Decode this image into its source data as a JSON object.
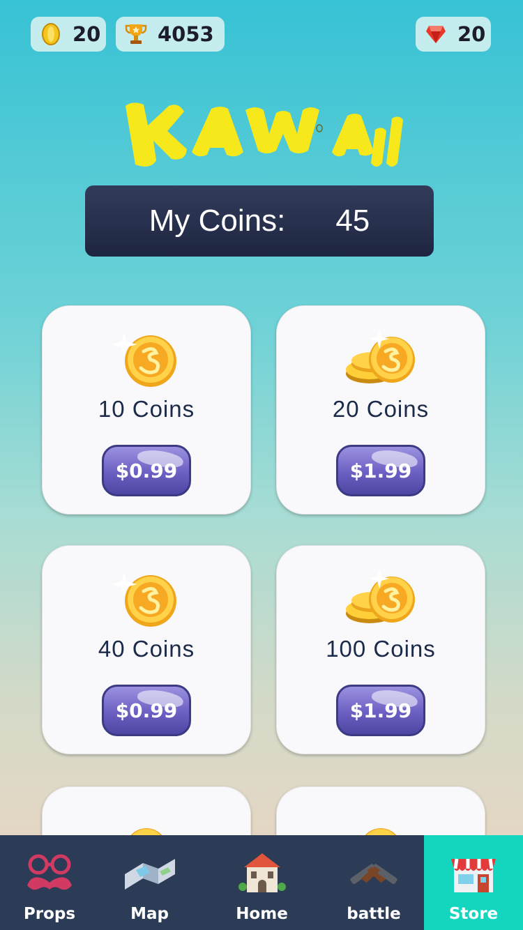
{
  "status": {
    "coins": "20",
    "trophies": "4053",
    "gems": "20"
  },
  "logo_text": "Kawaii",
  "my_coins": {
    "label": "My Coins:",
    "value": "45"
  },
  "products": [
    {
      "name": "10 Coins",
      "price": "$0.99",
      "icon": "single-coin-icon"
    },
    {
      "name": "20 Coins",
      "price": "$1.99",
      "icon": "coin-stack-icon"
    },
    {
      "name": "40 Coins",
      "price": "$0.99",
      "icon": "single-coin-icon"
    },
    {
      "name": "100 Coins",
      "price": "$1.99",
      "icon": "coin-stack-icon"
    }
  ],
  "nav": {
    "tabs": [
      {
        "label": "Props",
        "icon": "glasses-mustache-icon"
      },
      {
        "label": "Map",
        "icon": "map-icon"
      },
      {
        "label": "Home",
        "icon": "house-icon"
      },
      {
        "label": "battle",
        "icon": "pistols-icon"
      },
      {
        "label": "Store",
        "icon": "storefront-icon"
      }
    ],
    "active": "Store"
  },
  "colors": {
    "panel_dark": "#1d2540",
    "nav_bg": "#2c3b56",
    "nav_active": "#14d6bf",
    "button_purple": "#6a5fc2",
    "logo_yellow": "#f7e81c"
  }
}
